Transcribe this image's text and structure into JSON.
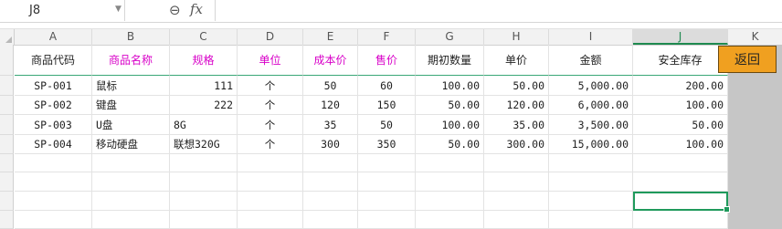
{
  "namebox": {
    "value": "J8"
  },
  "formula_bar": {
    "fx_label": "fx",
    "content": ""
  },
  "columns": [
    "A",
    "B",
    "C",
    "D",
    "E",
    "F",
    "G",
    "H",
    "I",
    "J",
    "K"
  ],
  "selected_column": "J",
  "header": {
    "product_code": "商品代码",
    "product_name": "商品名称",
    "spec": "规格",
    "unit": "单位",
    "cost_price": "成本价",
    "sale_price": "售价",
    "opening_qty": "期初数量",
    "unit_price": "单价",
    "amount": "金额",
    "safety_stock": "安全库存"
  },
  "rows": [
    {
      "code": "SP-001",
      "name": "鼠标",
      "spec": "111",
      "unit": "个",
      "cost": "50",
      "price": "60",
      "qty": "100.00",
      "unit_price": "50.00",
      "amount": "5,000.00",
      "safety": "200.00"
    },
    {
      "code": "SP-002",
      "name": "键盘",
      "spec": "222",
      "unit": "个",
      "cost": "120",
      "price": "150",
      "qty": "50.00",
      "unit_price": "120.00",
      "amount": "6,000.00",
      "safety": "100.00"
    },
    {
      "code": "SP-003",
      "name": "U盘",
      "spec": "8G",
      "unit": "个",
      "cost": "35",
      "price": "50",
      "qty": "100.00",
      "unit_price": "35.00",
      "amount": "3,500.00",
      "safety": "50.00"
    },
    {
      "code": "SP-004",
      "name": "移动硬盘",
      "spec": "联想320G",
      "unit": "个",
      "cost": "300",
      "price": "350",
      "qty": "50.00",
      "unit_price": "300.00",
      "amount": "15,000.00",
      "safety": "100.00"
    }
  ],
  "back_button": {
    "label": "返回",
    "color": "#f0a020"
  },
  "colors": {
    "header_accent": "#d800c8",
    "selection": "#1f9a5c"
  }
}
